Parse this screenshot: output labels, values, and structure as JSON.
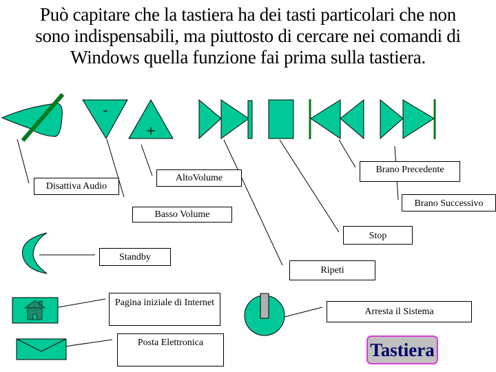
{
  "title": {
    "lines": [
      "Può capitare che la tastiera ha dei tasti particolari che non",
      "sono indispensabili, ma piuttosto di cercare nei comandi di",
      "Windows quella funzione fai prima sulla tastiera."
    ]
  },
  "icons": {
    "mute": "mute-speaker-icon",
    "volume_down": "volume-down-triangle-icon",
    "volume_down_symbol": "-",
    "volume_up": "volume-up-triangle-icon",
    "volume_up_symbol": "+",
    "next_track": "next-track-icon",
    "stop": "stop-icon",
    "previous_track": "previous-track-icon",
    "repeat": "repeat-icon",
    "standby": "moon-icon",
    "home": "home-icon",
    "mail": "envelope-icon",
    "power": "power-icon"
  },
  "labels": {
    "mute": "Disattiva Audio",
    "volume_up": "AltoVolume",
    "volume_down": "Basso Volume",
    "previous_track": "Brano Precedente",
    "next_track": "Brano Successivo",
    "stop": "Stop",
    "repeat": "Ripeti",
    "standby": "Standby",
    "home": "Pagina iniziale di Internet",
    "mail": "Posta Elettronica",
    "shutdown": "Arresta il Sistema"
  },
  "badge": {
    "text": "Tastiera"
  },
  "colors": {
    "icon_fill": "#00c896",
    "dark_green": "#007a1e",
    "house_fill": "#1e8a6a",
    "gray": "#b0b0b0",
    "badge_border": "#d43fd4",
    "badge_text": "#000066"
  }
}
